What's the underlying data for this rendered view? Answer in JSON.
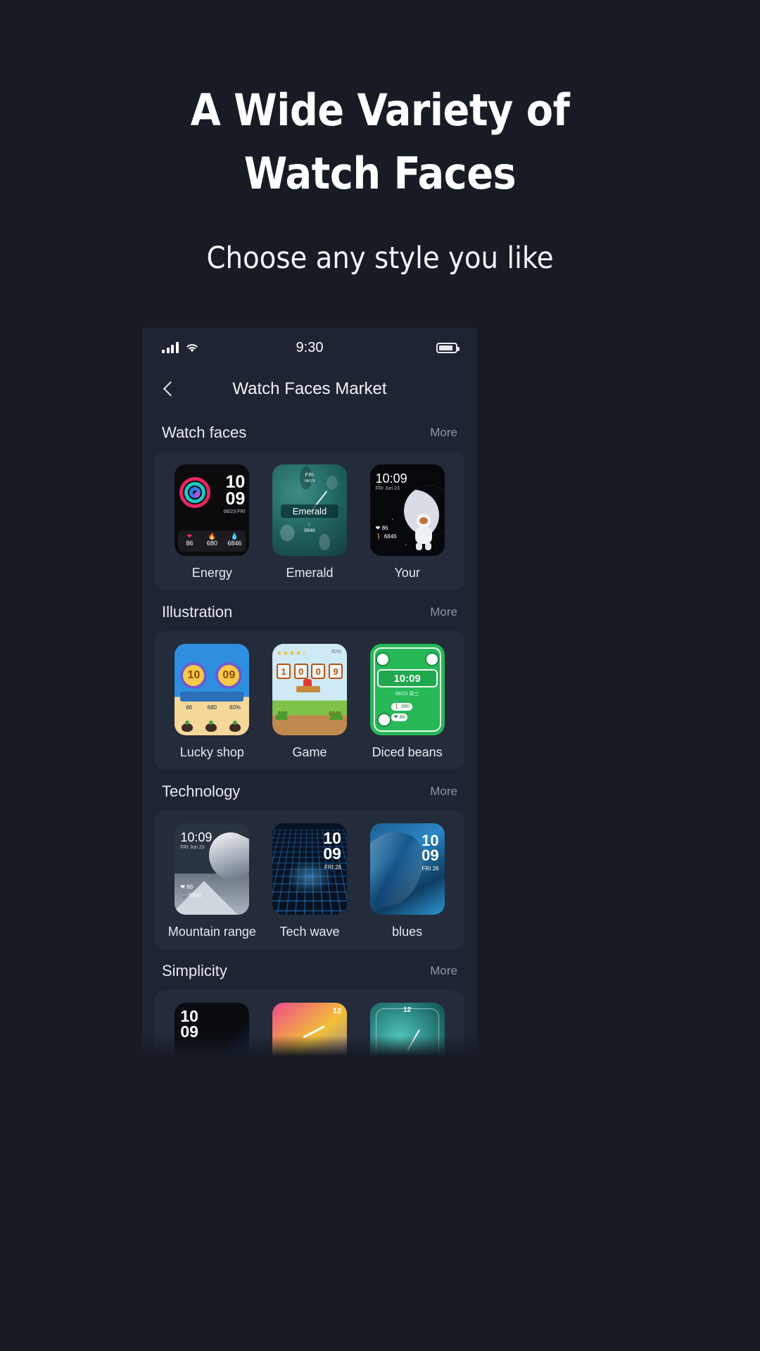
{
  "hero": {
    "title_line1": "A Wide Variety of",
    "title_line2": "Watch Faces",
    "subtitle": "Choose any style you like"
  },
  "phone": {
    "statusbar": {
      "time": "9:30",
      "signal_icon": "signal-bars-icon",
      "wifi_icon": "wifi-icon",
      "battery_icon": "battery-icon"
    },
    "navbar": {
      "back_icon": "back-chevron-icon",
      "title": "Watch Faces Market"
    },
    "sections": [
      {
        "title": "Watch faces",
        "more": "More",
        "items": [
          {
            "name": "Energy",
            "time": "10",
            "time2": "09",
            "date": "06/23  FRI",
            "hr": "86",
            "steps": "680",
            "cal": "6846"
          },
          {
            "name": "Emerald",
            "label": "Emerald",
            "weekday": "FRI",
            "date": "06/23",
            "steps_icon": "steps-icon",
            "steps": "6846"
          },
          {
            "name": "Your",
            "time": "10:09",
            "date": "FRI  Jun 23",
            "hr": "86",
            "steps": "6846"
          }
        ]
      },
      {
        "title": "Illustration",
        "more": "More",
        "items": [
          {
            "name": "Lucky shop",
            "hour": "10",
            "minute": "09",
            "hr": "86",
            "steps": "680",
            "battery": "80%"
          },
          {
            "name": "Game",
            "digits": [
              "1",
              "0",
              "0",
              "9"
            ],
            "stars": "★★★★☆",
            "battery": "80%",
            "steps": "680",
            "cal": "6846"
          },
          {
            "name": "Diced beans",
            "time": "10:09",
            "date": "06/23 周三",
            "steps": "680",
            "hr": "86"
          }
        ]
      },
      {
        "title": "Technology",
        "more": "More",
        "items": [
          {
            "name": "Mountain range",
            "time": "10:09",
            "date": "FRI  Jun 23",
            "hr": "86",
            "steps": "6846"
          },
          {
            "name": "Tech wave",
            "time": "10",
            "time2": "09",
            "date": "FRI 26"
          },
          {
            "name": "blues",
            "time": "10",
            "time2": "09",
            "date": "FRI 26"
          }
        ]
      },
      {
        "title": "Simplicity",
        "more": "More",
        "items": [
          {
            "name": "",
            "time": "10",
            "time2": "09"
          },
          {
            "name": "",
            "marker": "12"
          },
          {
            "name": "",
            "marker": "12"
          }
        ]
      }
    ]
  },
  "colors": {
    "page_bg": "#161b24",
    "phone_bg": "#1e2431",
    "card_bg": "#242b3a",
    "text_primary": "#e8ebf0",
    "text_muted": "#8e96a5"
  }
}
